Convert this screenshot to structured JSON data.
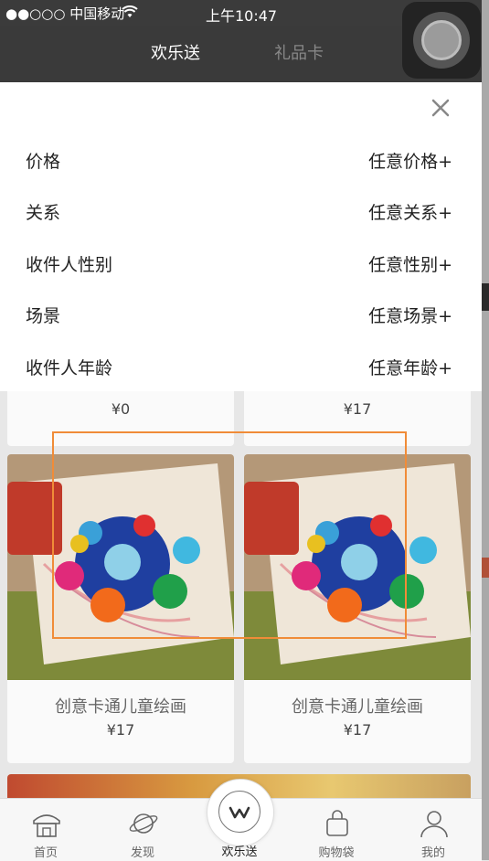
{
  "status_bar": {
    "carrier": "●●○○○ 中国移动 ",
    "wifi": "wifi-icon",
    "time": "上午10:47",
    "battery": "battery-icon"
  },
  "header": {
    "tabs": [
      {
        "label": "欢乐送",
        "active": true
      },
      {
        "label": "礼品卡",
        "active": false
      }
    ]
  },
  "filter": {
    "close_icon": "close-icon",
    "rows": [
      {
        "label": "价格",
        "value": "任意价格+"
      },
      {
        "label": "关系",
        "value": "任意关系+"
      },
      {
        "label": "收件人性别",
        "value": "任意性别+"
      },
      {
        "label": "场景",
        "value": "任意场景+"
      },
      {
        "label": "收件人年龄",
        "value": "任意年龄+"
      }
    ]
  },
  "products": {
    "top_row": [
      {
        "price": "¥0"
      },
      {
        "price": "¥17"
      }
    ],
    "items": [
      {
        "name": "创意卡通儿童绘画",
        "price": "¥17"
      },
      {
        "name": "创意卡通儿童绘画",
        "price": "¥17"
      }
    ]
  },
  "tab_bar": {
    "items": [
      {
        "label": "首页",
        "icon": "home-icon"
      },
      {
        "label": "发现",
        "icon": "planet-icon"
      },
      {
        "label": "欢乐送",
        "icon": "w-logo-icon"
      },
      {
        "label": "购物袋",
        "icon": "bag-icon"
      },
      {
        "label": "我的",
        "icon": "person-icon"
      }
    ]
  },
  "colors": {
    "header_bg": "#3a3a3a",
    "highlight": "#f08c38",
    "panel_bg": "#ffffff"
  }
}
